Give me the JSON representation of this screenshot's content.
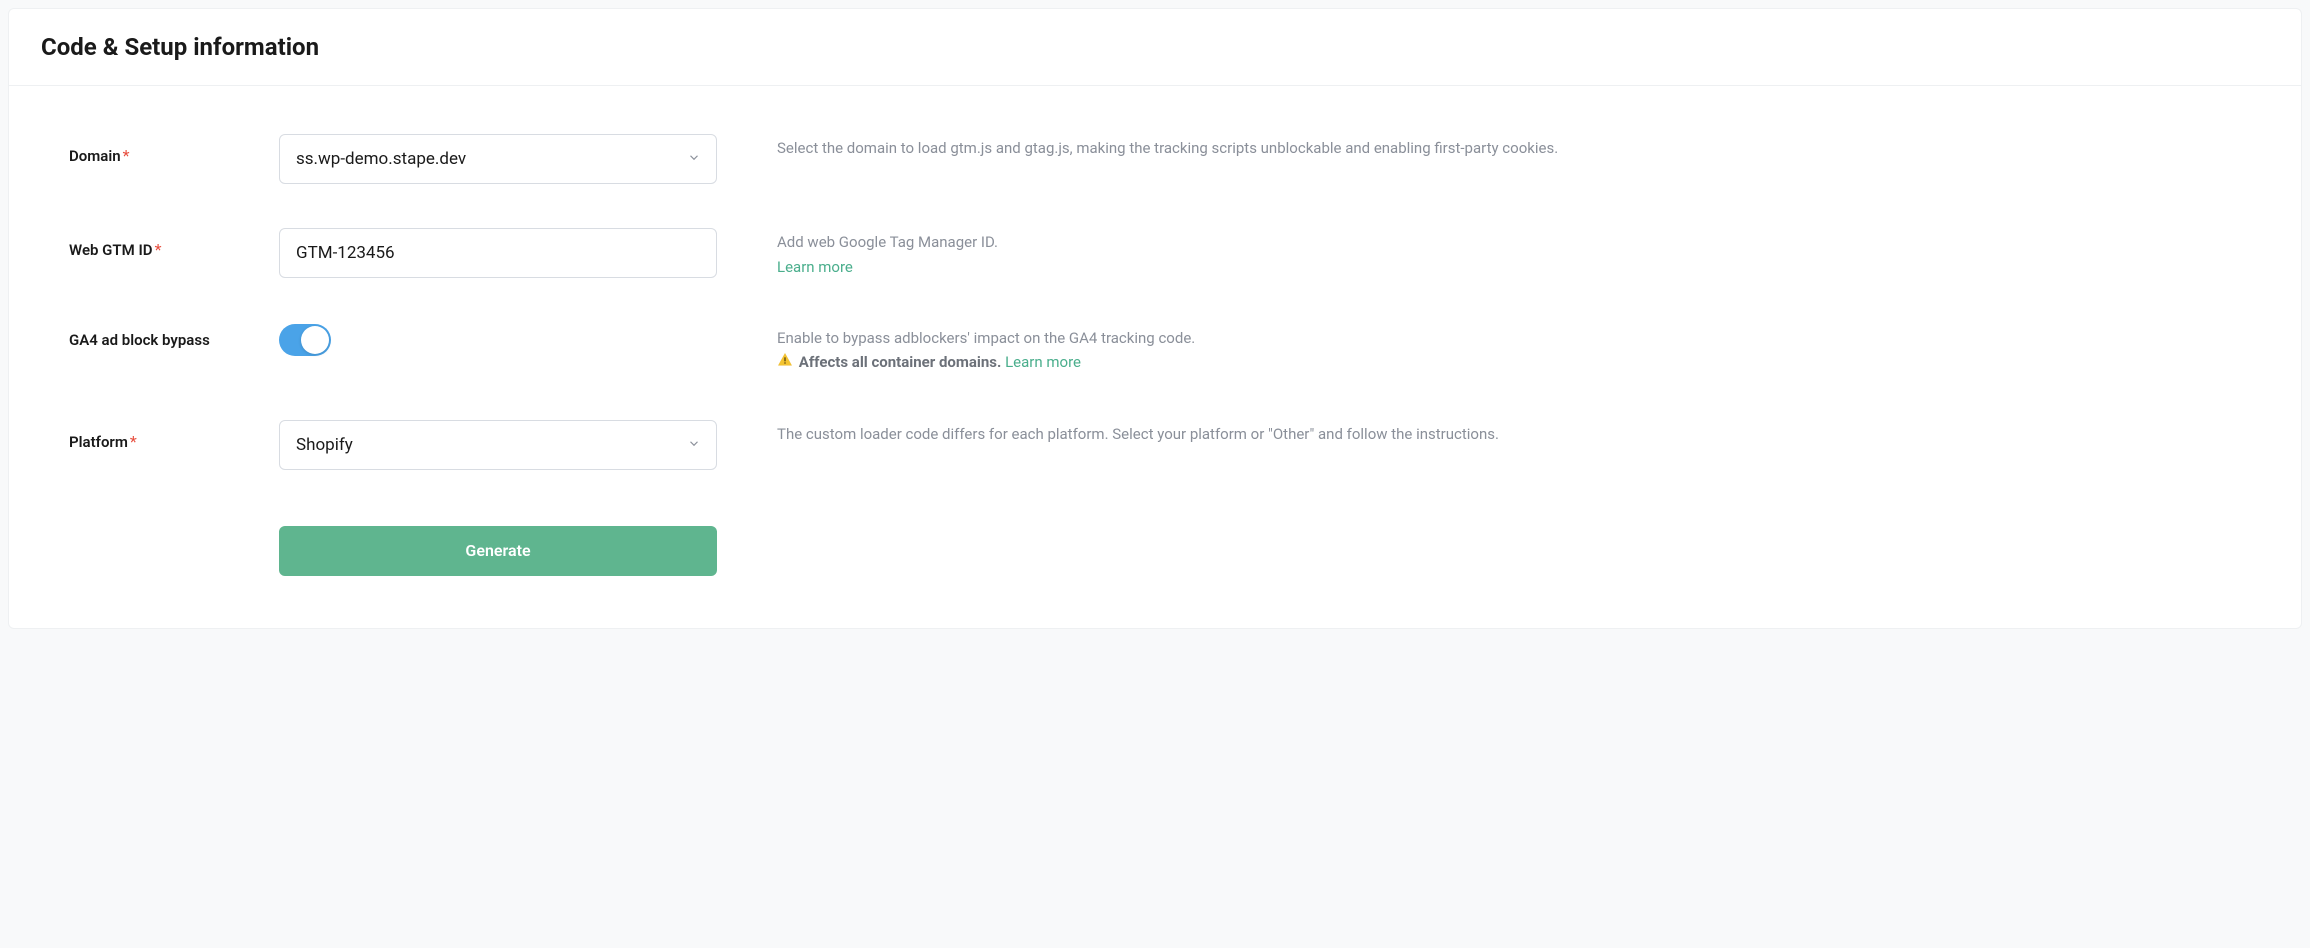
{
  "header": {
    "title": "Code & Setup information"
  },
  "form": {
    "domain": {
      "label": "Domain",
      "required": "*",
      "value": "ss.wp-demo.stape.dev",
      "help": "Select the domain to load gtm.js and gtag.js, making the tracking scripts unblockable and enabling first-party cookies."
    },
    "gtm": {
      "label": "Web GTM ID",
      "required": "*",
      "value": "GTM-123456",
      "help": "Add web Google Tag Manager ID.",
      "learn_more": "Learn more"
    },
    "ga4": {
      "label": "GA4 ad block bypass",
      "enabled": true,
      "help": "Enable to bypass adblockers' impact on the GA4 tracking code.",
      "warning": "Affects all container domains.",
      "learn_more": "Learn more"
    },
    "platform": {
      "label": "Platform",
      "required": "*",
      "value": "Shopify",
      "help": "The custom loader code differs for each platform. Select your platform or \"Other\" and follow the instructions."
    },
    "generate_label": "Generate"
  }
}
